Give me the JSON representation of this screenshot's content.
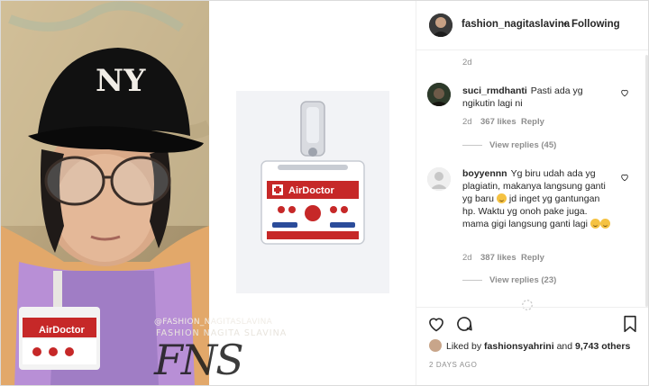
{
  "post": {
    "author": "fashion_nagitaslavina",
    "follow_status": "Following",
    "top_meta": "2d",
    "watermark_handle": "@FASHION_NAGITASLAVINA",
    "watermark_name": "FASHION NAGITA SLAVINA",
    "watermark_monogram": "FNS",
    "lanyard_text": "AirDoctor",
    "badge_text": "AirDoctor"
  },
  "comments": [
    {
      "user": "suci_rmdhanti",
      "text": "Pasti ada yg ngikutin lagi ni",
      "age": "2d",
      "likes": "367 likes",
      "reply": "Reply",
      "view_replies": "View replies (45)"
    },
    {
      "user": "boyyennn",
      "text_1": "Yg biru udah ada yg plagiatin, makanya langsung ganti yg baru",
      "text_2": "jd inget yg gantungan hp. Waktu yg onoh pake juga. mama gigi langsung ganti lagi",
      "age": "2d",
      "likes": "387 likes",
      "reply": "Reply",
      "view_replies": "View replies (23)"
    }
  ],
  "likes": {
    "prefix": "Liked by",
    "user": "fashionsyahrini",
    "middle": "and",
    "count": "9,743 others"
  },
  "timestamp": "2 DAYS AGO",
  "icons": [
    "heart-icon",
    "comment-icon",
    "bookmark-icon"
  ],
  "colors": {
    "text": "#262626",
    "muted": "#8e8e8e",
    "border": "#efefef",
    "badge_red": "#c62828"
  }
}
